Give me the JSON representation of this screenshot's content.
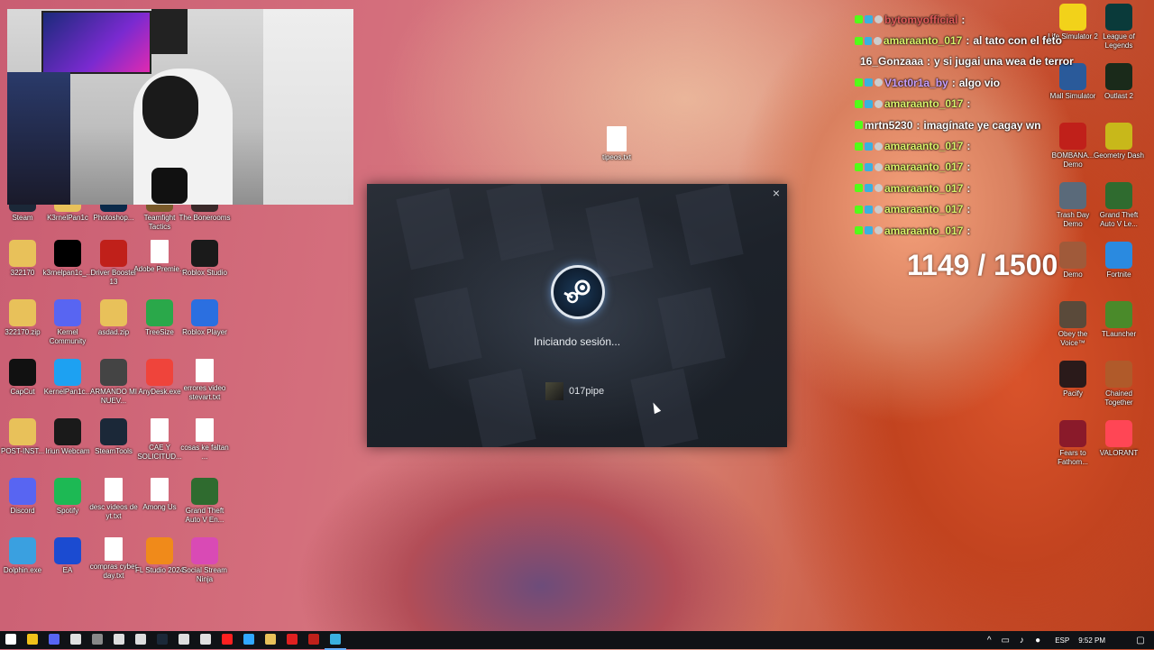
{
  "desktop_icons_left": [
    {
      "label": "Steam",
      "icon": "steam-icon",
      "color": "#1b2838"
    },
    {
      "label": "K3rnelPan1c",
      "icon": "folder-icon",
      "color": "#e8c15a"
    },
    {
      "label": "Photoshop...",
      "icon": "photoshop-icon",
      "color": "#0b2a4a"
    },
    {
      "label": "Teamfight Tactics",
      "icon": "tft-icon",
      "color": "#7a5a2a"
    },
    {
      "label": "The Bonerooms",
      "icon": "game-icon",
      "color": "#3a2a2a"
    },
    {
      "label": "322170",
      "icon": "folder-icon",
      "color": "#e8c15a"
    },
    {
      "label": "k3rnelpan1c_...",
      "icon": "tiktok-icon",
      "color": "#000000"
    },
    {
      "label": "Driver Booster 13",
      "icon": "driver-booster-icon",
      "color": "#c0201a"
    },
    {
      "label": "Adobe Premie...",
      "icon": "text-file-icon",
      "color": "#ffffff"
    },
    {
      "label": "Roblox Studio",
      "icon": "roblox-studio-icon",
      "color": "#1a1a1a"
    },
    {
      "label": "322170.zip",
      "icon": "zip-folder-icon",
      "color": "#e8c15a"
    },
    {
      "label": "Kernel Community",
      "icon": "discord-icon",
      "color": "#5865f2"
    },
    {
      "label": "asdad.zip",
      "icon": "zip-folder-icon",
      "color": "#e8c15a"
    },
    {
      "label": "TreeSize",
      "icon": "treesize-icon",
      "color": "#2aa84a"
    },
    {
      "label": "Roblox Player",
      "icon": "roblox-icon",
      "color": "#2b6fe0"
    },
    {
      "label": "CapCut",
      "icon": "capcut-icon",
      "color": "#111111"
    },
    {
      "label": "KernelPan1c...",
      "icon": "twitter-icon",
      "color": "#1da1f2"
    },
    {
      "label": "ARMANDO MI NUEV...",
      "icon": "image-icon",
      "color": "#444444"
    },
    {
      "label": "AnyDesk.exe",
      "icon": "anydesk-icon",
      "color": "#ef443b"
    },
    {
      "label": "errores video stevart.txt",
      "icon": "text-file-icon",
      "color": "#ffffff"
    },
    {
      "label": "POST-INST...",
      "icon": "folder-icon",
      "color": "#e8c15a"
    },
    {
      "label": "Iriun Webcam",
      "icon": "iriun-icon",
      "color": "#1a1a1a"
    },
    {
      "label": "SteamTools",
      "icon": "steam-icon",
      "color": "#1b2838"
    },
    {
      "label": "CAE Y SOLICITUD...",
      "icon": "text-file-icon",
      "color": "#ffffff"
    },
    {
      "label": "cosas ke faltan ...",
      "icon": "text-file-icon",
      "color": "#ffffff"
    },
    {
      "label": "Discord",
      "icon": "discord-icon",
      "color": "#5865f2"
    },
    {
      "label": "Spotify",
      "icon": "spotify-icon",
      "color": "#1db954"
    },
    {
      "label": "desc videos de yt.txt",
      "icon": "text-file-icon",
      "color": "#ffffff"
    },
    {
      "label": "Among Us",
      "icon": "text-file-icon",
      "color": "#ffffff"
    },
    {
      "label": "Grand Theft Auto V En...",
      "icon": "gta-icon",
      "color": "#2f6b2f"
    },
    {
      "label": "Dolphin.exe",
      "icon": "dolphin-icon",
      "color": "#3aa0e0"
    },
    {
      "label": "EA",
      "icon": "ea-icon",
      "color": "#1b4bd1"
    },
    {
      "label": "compras cyber day.txt",
      "icon": "text-file-icon",
      "color": "#ffffff"
    },
    {
      "label": "FL Studio 2024",
      "icon": "fl-studio-icon",
      "color": "#f08a1a"
    },
    {
      "label": "Social Stream Ninja",
      "icon": "social-stream-icon",
      "color": "#d94ab5"
    }
  ],
  "desktop_icons_right": [
    {
      "label": "Life Simulator 2",
      "icon": "game-icon",
      "color": "#f2d21a"
    },
    {
      "label": "League of Legends",
      "icon": "lol-icon",
      "color": "#0a3a3a"
    },
    {
      "label": "Mall Simulator",
      "icon": "game-icon",
      "color": "#2a5a9a"
    },
    {
      "label": "Outlast 2",
      "icon": "game-icon",
      "color": "#1a2a1a"
    },
    {
      "label": "BOMBANA... Demo",
      "icon": "game-icon",
      "color": "#c0201a"
    },
    {
      "label": "Geometry Dash",
      "icon": "geometry-dash-icon",
      "color": "#c8b81a"
    },
    {
      "label": "Trash Day Demo",
      "icon": "game-icon",
      "color": "#5a6a7a"
    },
    {
      "label": "Grand Theft Auto V Le...",
      "icon": "gta-icon",
      "color": "#2f6b2f"
    },
    {
      "label": "Demo",
      "icon": "game-icon",
      "color": "#a05a3a"
    },
    {
      "label": "Fortnite",
      "icon": "fortnite-icon",
      "color": "#2a8ae0"
    },
    {
      "label": "Obey the Voice™",
      "icon": "game-icon",
      "color": "#5a4a3a"
    },
    {
      "label": "TLauncher",
      "icon": "minecraft-icon",
      "color": "#4a8a2a"
    },
    {
      "label": "Pacify",
      "icon": "game-icon",
      "color": "#2a1a1a"
    },
    {
      "label": "Chained Together",
      "icon": "game-icon",
      "color": "#b05a2a"
    },
    {
      "label": "Fears to Fathom...",
      "icon": "f2f-icon",
      "color": "#8a1a2a"
    },
    {
      "label": "VALORANT",
      "icon": "valorant-icon",
      "color": "#ff4655"
    }
  ],
  "desktop_file_center": {
    "label": "tipeos.txt",
    "icon": "text-file-icon"
  },
  "steam_login": {
    "status": "Iniciando sesión...",
    "username": "017pipe",
    "close": "×"
  },
  "chat": [
    {
      "user": "bytomyofficial",
      "msg": "",
      "user_color": "#e05a5a"
    },
    {
      "user": "amaraanto_017",
      "msg": "al tato con el feto",
      "user_color": "#d9f26a"
    },
    {
      "user": "16_Gonzaaa",
      "msg": "y si jugai una wea de terror",
      "user_color": "#ffffff"
    },
    {
      "user": "V1ct0r1a_by",
      "msg": "algo vio",
      "user_color": "#c9a0ff"
    },
    {
      "user": "amaraanto_017",
      "msg": "",
      "user_color": "#d9f26a"
    },
    {
      "user": "mrtn5230",
      "msg": "imagínate ye cagay wn",
      "user_color": "#ffffff"
    },
    {
      "user": "amaraanto_017",
      "msg": "",
      "user_color": "#d9f26a"
    },
    {
      "user": "amaraanto_017",
      "msg": "",
      "user_color": "#d9f26a"
    },
    {
      "user": "amaraanto_017",
      "msg": "",
      "user_color": "#d9f26a"
    },
    {
      "user": "amaraanto_017",
      "msg": "",
      "user_color": "#d9f26a"
    },
    {
      "user": "amaraanto_017",
      "msg": "",
      "user_color": "#d9f26a"
    }
  ],
  "counter": "1149 / 1500",
  "taskbar": {
    "apps": [
      "start-icon",
      "file-explorer-icon",
      "discord-icon",
      "chrome-icon",
      "obs-icon",
      "steamtools-icon",
      "capcut-icon",
      "steam-icon",
      "app-icon",
      "chrome-icon",
      "youtube-icon",
      "photoshop-icon",
      "folder-icon",
      "record-icon",
      "app-icon",
      "steam-icon"
    ],
    "lang": "ESP",
    "time": "9:52 PM"
  }
}
